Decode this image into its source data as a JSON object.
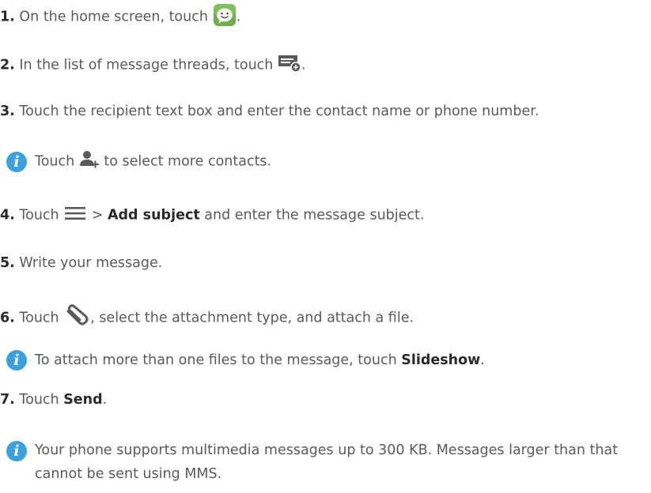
{
  "steps": [
    {
      "num": "1.",
      "text_before": " On the home screen, touch ",
      "text_after": "."
    },
    {
      "num": "2.",
      "text_before": " In the list of message threads, touch ",
      "text_after": "."
    },
    {
      "num": "3.",
      "text": " Touch the recipient text box and enter the contact name or phone number."
    },
    {
      "num": "4.",
      "text_before": " Touch ",
      "text_mid": " > ",
      "bold": "Add subject",
      "text_after": " and enter the message subject."
    },
    {
      "num": "5.",
      "text": " Write your message."
    },
    {
      "num": "6.",
      "text_before": " Touch ",
      "text_after": ", select the attachment type, and attach a file."
    },
    {
      "num": "7.",
      "text_before": " Touch ",
      "bold": "Send",
      "text_after": "."
    }
  ],
  "notes": [
    {
      "text_before": "Touch ",
      "text_after": " to select more contacts."
    },
    {
      "text_before": "To attach more than one files to the message, touch ",
      "bold": "Slideshow",
      "text_after": "."
    },
    {
      "text": "Your phone supports multimedia messages up to 300 KB. Messages larger than that cannot be sent using MMS."
    }
  ],
  "note_icon_glyph": "i",
  "icons": {
    "messaging_app": "messaging-app-icon",
    "new_message": "new-message-icon",
    "add_contact": "add-contact-icon",
    "menu": "menu-icon",
    "attachment": "paperclip-icon",
    "info": "info-icon"
  },
  "colors": {
    "info_badge": "#3aa0e0",
    "app_icon_green": "#6bb04a",
    "text": "#5a5a5a",
    "bold": "#2a2a2a"
  }
}
